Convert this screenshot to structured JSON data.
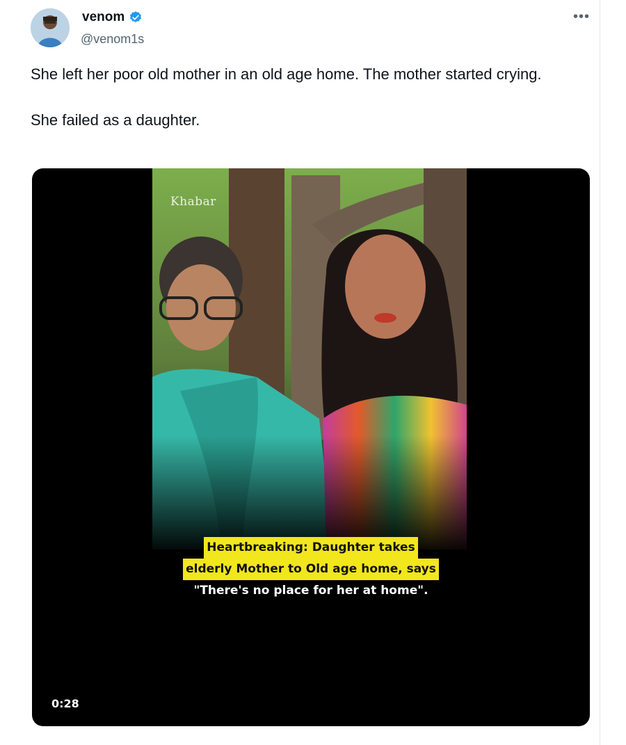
{
  "tweet": {
    "author": {
      "name": "venom",
      "handle": "@venom1s",
      "verified": true
    },
    "more_icon": "more-horizontal-icon",
    "text_lines": [
      "She left her poor old mother in an old age home. The mother started crying.",
      "She failed as a daughter."
    ],
    "media": {
      "type": "video",
      "watermark": "Khabar",
      "caption_lines": [
        "Heartbreaking: Daughter takes",
        "elderly Mother to Old age home, says",
        "\"There's no place for her at home\"."
      ],
      "duration": "0:28"
    }
  },
  "colors": {
    "verified": "#1d9bf0",
    "caption_highlight": "#f2e61c",
    "text": "#0f1419",
    "secondary_text": "#536471"
  }
}
